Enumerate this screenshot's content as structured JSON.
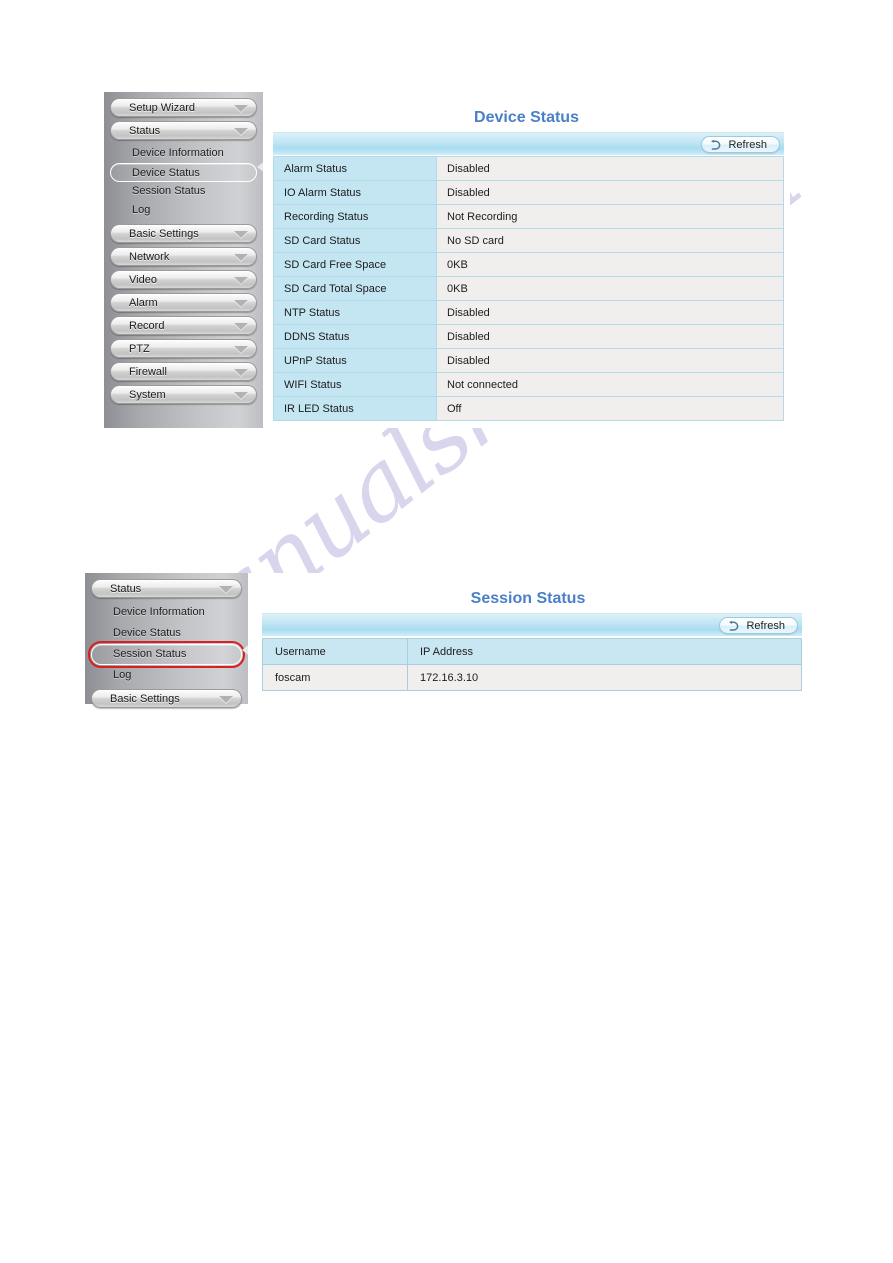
{
  "watermark": {
    "text": "manualshive.com"
  },
  "device_status_panel": {
    "title": "Device Status",
    "toolbar": {
      "refresh_label": "Refresh",
      "refresh_icon": "refresh-arrow-icon"
    },
    "sidebar": {
      "menu_items": [
        {
          "label": "Setup Wizard",
          "caret": "chevron-down-icon"
        },
        {
          "label": "Status",
          "caret": "chevron-down-icon"
        }
      ],
      "sub_items": [
        {
          "label": "Device Information",
          "selected": false
        },
        {
          "label": "Device Status",
          "selected": true
        },
        {
          "label": "Session Status",
          "selected": false
        },
        {
          "label": "Log",
          "selected": false
        }
      ],
      "menu_items_lower": [
        {
          "label": "Basic Settings",
          "caret": "chevron-down-icon"
        },
        {
          "label": "Network",
          "caret": "chevron-down-icon"
        },
        {
          "label": "Video",
          "caret": "chevron-down-icon"
        },
        {
          "label": "Alarm",
          "caret": "chevron-down-icon"
        },
        {
          "label": "Record",
          "caret": "chevron-down-icon"
        },
        {
          "label": "PTZ",
          "caret": "chevron-down-icon"
        },
        {
          "label": "Firewall",
          "caret": "chevron-down-icon"
        },
        {
          "label": "System",
          "caret": "chevron-down-icon"
        }
      ]
    },
    "rows": [
      {
        "key": "Alarm Status",
        "value": "Disabled"
      },
      {
        "key": "IO Alarm Status",
        "value": "Disabled"
      },
      {
        "key": "Recording Status",
        "value": "Not Recording"
      },
      {
        "key": "SD Card Status",
        "value": "No SD card"
      },
      {
        "key": "SD Card Free Space",
        "value": "0KB"
      },
      {
        "key": "SD Card Total Space",
        "value": "0KB"
      },
      {
        "key": "NTP Status",
        "value": "Disabled"
      },
      {
        "key": "DDNS Status",
        "value": "Disabled"
      },
      {
        "key": "UPnP Status",
        "value": "Disabled"
      },
      {
        "key": "WIFI Status",
        "value": "Not connected"
      },
      {
        "key": "IR LED Status",
        "value": "Off"
      }
    ]
  },
  "session_status_panel": {
    "title": "Session Status",
    "toolbar": {
      "refresh_label": "Refresh",
      "refresh_icon": "refresh-arrow-icon"
    },
    "sidebar": {
      "menu_items": [
        {
          "label": "Status",
          "caret": "chevron-down-icon"
        }
      ],
      "sub_items": [
        {
          "label": "Device Information",
          "selected": false,
          "highlight": false
        },
        {
          "label": "Device Status",
          "selected": false,
          "highlight": false
        },
        {
          "label": "Session Status",
          "selected": true,
          "highlight": true
        },
        {
          "label": "Log",
          "selected": false,
          "highlight": false
        }
      ],
      "menu_items_lower": [
        {
          "label": "Basic Settings",
          "caret": "chevron-down-icon"
        }
      ]
    },
    "table": {
      "columns": [
        "Username",
        "IP Address"
      ],
      "rows": [
        {
          "username": "foscam",
          "ip": "172.16.3.10"
        }
      ]
    },
    "highlight_color": "#d91f1f"
  }
}
